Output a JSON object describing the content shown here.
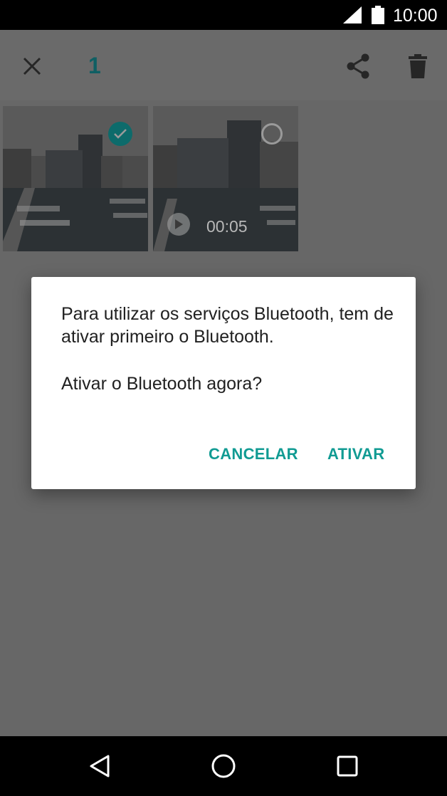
{
  "status_bar": {
    "time": "10:00",
    "icons": [
      "signal-icon",
      "battery-icon"
    ]
  },
  "app_bar": {
    "selected_count": "1",
    "actions": [
      "close-icon",
      "share-icon",
      "delete-icon"
    ],
    "accent_color": "#0f5f63"
  },
  "gallery": {
    "items": [
      {
        "type": "photo",
        "selected": true
      },
      {
        "type": "video",
        "selected": false,
        "duration": "00:05"
      }
    ]
  },
  "dialog": {
    "message": "Para utilizar os serviços Bluetooth, tem de ativar primeiro o Bluetooth.",
    "question": "Ativar o Bluetooth agora?",
    "cancel_label": "CANCELAR",
    "confirm_label": "ATIVAR",
    "button_color": "#119b93"
  },
  "nav_bar": {
    "buttons": [
      "back-icon",
      "home-icon",
      "recents-icon"
    ]
  }
}
